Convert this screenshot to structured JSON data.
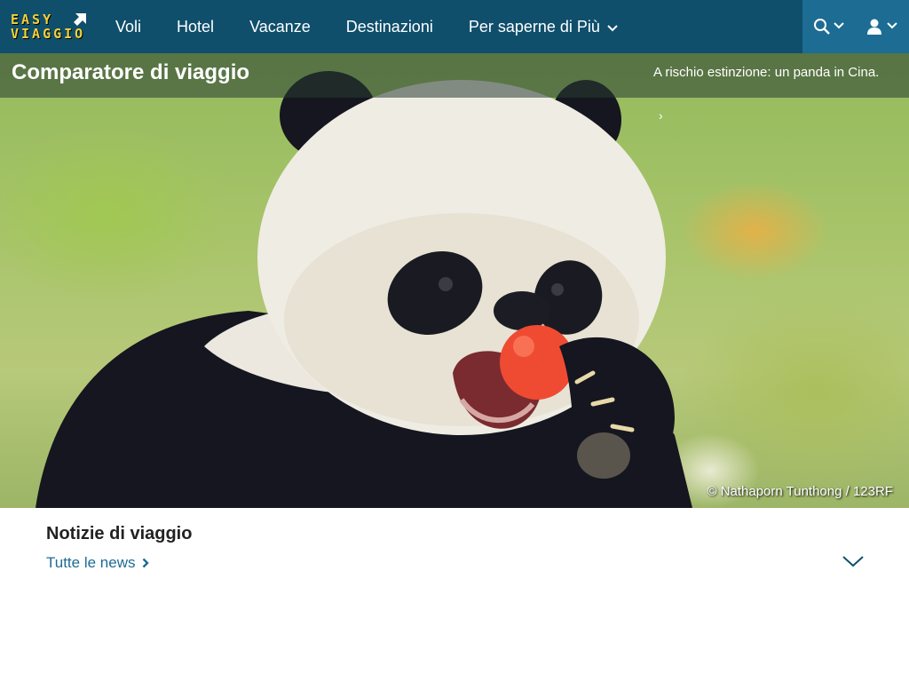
{
  "brand": {
    "line1": "EASY",
    "line2": "VIAGGIO",
    "logo_color": "#f2d13a"
  },
  "nav": {
    "items": [
      {
        "label": "Voli"
      },
      {
        "label": "Hotel"
      },
      {
        "label": "Vacanze"
      },
      {
        "label": "Destinazioni"
      },
      {
        "label": "Per saperne di Più",
        "has_dropdown": true
      }
    ],
    "search_icon": "search-icon",
    "user_icon": "user-icon",
    "bar_color": "#0f4f6c",
    "accent_color": "#1d6c93"
  },
  "hero": {
    "page_title": "Comparatore di viaggio",
    "caption": "A rischio estinzione: un panda in Cina.",
    "caption_chevron": "›",
    "credit": "© Nathaporn Tunthong / 123RF"
  },
  "news": {
    "title": "Notizie di viaggio",
    "link_label": "Tutte le news",
    "link_color": "#1d6c93"
  }
}
